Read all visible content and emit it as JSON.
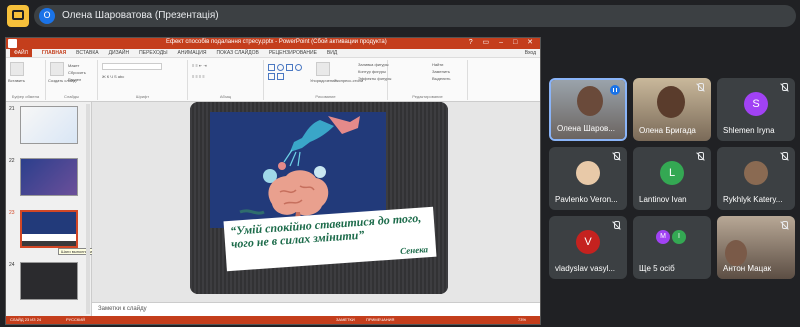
{
  "meet": {
    "presenter_initial": "O",
    "presenter_title": "Олена Шароватова (Презентація)"
  },
  "ppt": {
    "doc_title": "Ефект способів подалання стресу.pptx - PowerPoint (Сбой активации продукта)",
    "window_controls": "? ▭ – □ ✕",
    "tabs": [
      "ФАЙЛ",
      "ГЛАВНАЯ",
      "ВСТАВКА",
      "ДИЗАЙН",
      "ПЕРЕХОДЫ",
      "АНИМАЦИЯ",
      "ПОКАЗ СЛАЙДОВ",
      "РЕЦЕНЗИРОВАНИЕ",
      "ВИД"
    ],
    "signin": "Вход",
    "ribbon": {
      "paste": "Вставить",
      "new_slide": "Создать слайд",
      "layout": "Макет",
      "reset": "Сбросить",
      "section": "Раздел",
      "clipboard": "Буфер обмена",
      "slides": "Слайды",
      "font": "Шрифт",
      "paragraph": "Абзац",
      "arrange": "Упорядочение",
      "quick_styles": "Экспресс-стили",
      "shape_fill": "Заливка фигуры",
      "shape_outline": "Контур фигуры",
      "shape_effects": "Эффекты фигуры",
      "drawing": "Рисование",
      "find": "Найти",
      "replace": "Заменить",
      "select": "Выделить",
      "editing": "Редактирование"
    },
    "thumbnails": [
      {
        "num": "21"
      },
      {
        "num": "22"
      },
      {
        "num": "23"
      },
      {
        "num": "24"
      }
    ],
    "thumb_tooltip": "Шаги выполнения",
    "slide": {
      "quote": "“Умій спокійно ставитися до того, чого не в силах змінити”",
      "author": "Сенека"
    },
    "notes_placeholder": "Заметки к слайду",
    "status": {
      "slide_info": "СЛАЙД 23 ИЗ 24",
      "language": "РУССКИЙ",
      "notes": "ЗАМЕТКИ",
      "comments": "ПРИМЕЧАНИЯ",
      "zoom": "73%"
    }
  },
  "participants": [
    {
      "name": "Олена Шаров...",
      "type": "video",
      "speaking": true
    },
    {
      "name": "Олена Бригада",
      "type": "video",
      "muted": true
    },
    {
      "name": "Shlemen Iryna",
      "type": "avatar",
      "initial": "S",
      "color": "#a142f4",
      "muted": true
    },
    {
      "name": "Pavlenko Veron...",
      "type": "photo",
      "muted": true
    },
    {
      "name": "Lantinov Ivan",
      "type": "avatar",
      "initial": "L",
      "color": "#34a853",
      "muted": true
    },
    {
      "name": "Rykhlyk Katery...",
      "type": "photo",
      "muted": true
    },
    {
      "name": "vladyslav vasyl...",
      "type": "avatar",
      "initial": "V",
      "color": "#c5221f",
      "muted": true
    },
    {
      "name": "Ще 5 осіб",
      "type": "group",
      "initials": [
        "M",
        "I"
      ]
    },
    {
      "name": "Антон Мацак",
      "type": "video",
      "muted": true
    }
  ],
  "colors": {
    "accent": "#8ab4f8",
    "ppt_brand": "#c43e1c",
    "quote_green": "#1c6b4a"
  }
}
